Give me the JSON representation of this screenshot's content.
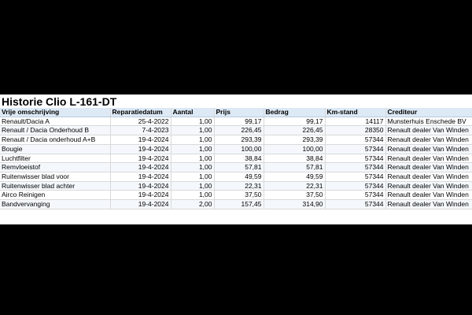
{
  "sheet": {
    "title": "Historie Clio L-161-DT",
    "headers": [
      "Vrije omschrijving",
      "Reparatiedatum",
      "Aantal",
      "Prijs",
      "Bedrag",
      "Km-stand",
      "Crediteur"
    ],
    "rows": [
      [
        "Renault/Dacia A",
        "25-4-2022",
        "1,00",
        "99,17",
        "99,17",
        "14117",
        "Munsterhuis Enschede BV"
      ],
      [
        "Renault / Dacia Onderhoud B",
        "7-4-2023",
        "1,00",
        "226,45",
        "226,45",
        "28350",
        "Renault dealer Van Winden"
      ],
      [
        "Renault / Dacia onderhoud A+B",
        "19-4-2024",
        "1,00",
        "293,39",
        "293,39",
        "57344",
        "Renault dealer Van Winden"
      ],
      [
        "Bougie",
        "19-4-2024",
        "1,00",
        "100,00",
        "100,00",
        "57344",
        "Renault dealer Van Winden"
      ],
      [
        "Luchtfilter",
        "19-4-2024",
        "1,00",
        "38,84",
        "38,84",
        "57344",
        "Renault dealer Van Winden"
      ],
      [
        "Remvloeistof",
        "19-4-2024",
        "1,00",
        "57,81",
        "57,81",
        "57344",
        "Renault dealer Van Winden"
      ],
      [
        "Ruitenwisser blad voor",
        "19-4-2024",
        "1,00",
        "49,59",
        "49,59",
        "57344",
        "Renault dealer Van Winden"
      ],
      [
        "Ruitenwisser blad achter",
        "19-4-2024",
        "1,00",
        "22,31",
        "22,31",
        "57344",
        "Renault dealer Van Winden"
      ],
      [
        "Airco Reinigen",
        "19-4-2024",
        "1,00",
        "37,50",
        "37,50",
        "57344",
        "Renault dealer Van Winden"
      ],
      [
        "Bandvervanging",
        "19-4-2024",
        "2,00",
        "157,45",
        "314,90",
        "57344",
        "Renault dealer Van Winden"
      ]
    ]
  }
}
